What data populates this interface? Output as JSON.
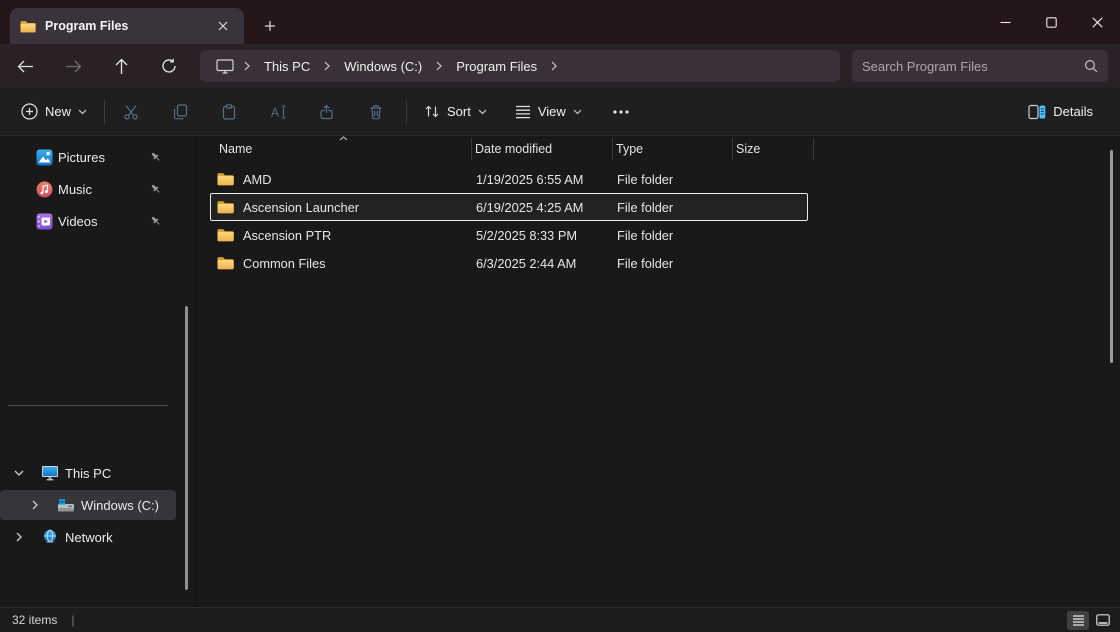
{
  "colors": {
    "accent_blue": "#4cc2ff",
    "folder_yellow": "#f5c24b",
    "titlebar_bg": "#251619",
    "tab_bg": "#3a333c",
    "navbar_bg": "#2a2127",
    "field_bg": "#393137",
    "content_bg": "#191919",
    "selection_outline": "#eaeaea",
    "disabled_icon_blue": "#50718f"
  },
  "titlebar": {
    "tab": {
      "label": "Program Files"
    }
  },
  "navbar": {
    "breadcrumbs": [
      "This PC",
      "Windows (C:)",
      "Program Files"
    ],
    "search": {
      "placeholder": "Search Program Files"
    }
  },
  "toolbar": {
    "new_label": "New",
    "sort_label": "Sort",
    "view_label": "View",
    "details_label": "Details"
  },
  "sidebar": {
    "pinned": [
      {
        "label": "Pictures",
        "icon": "pictures-icon",
        "pinned": true
      },
      {
        "label": "Music",
        "icon": "music-icon",
        "pinned": true
      },
      {
        "label": "Videos",
        "icon": "videos-icon",
        "pinned": true
      }
    ],
    "tree": [
      {
        "label": "This PC",
        "icon": "this-pc-icon",
        "expanded": true,
        "selected": false
      },
      {
        "label": "Windows (C:)",
        "icon": "drive-icon",
        "expanded": false,
        "selected": true
      },
      {
        "label": "Network",
        "icon": "network-icon",
        "expanded": false,
        "selected": false
      }
    ]
  },
  "filelist": {
    "columns": [
      "Name",
      "Date modified",
      "Type",
      "Size"
    ],
    "sort": {
      "column": "Name",
      "direction": "ascending"
    },
    "rows": [
      {
        "name": "AMD",
        "date_modified": "1/19/2025 6:55 AM",
        "type": "File folder",
        "size": "",
        "selected": false
      },
      {
        "name": "Ascension Launcher",
        "date_modified": "6/19/2025 4:25 AM",
        "type": "File folder",
        "size": "",
        "selected": true
      },
      {
        "name": "Ascension PTR",
        "date_modified": "5/2/2025 8:33 PM",
        "type": "File folder",
        "size": "",
        "selected": false
      },
      {
        "name": "Common Files",
        "date_modified": "6/3/2025 2:44 AM",
        "type": "File folder",
        "size": "",
        "selected": false
      }
    ]
  },
  "statusbar": {
    "items_count": "32 items"
  }
}
